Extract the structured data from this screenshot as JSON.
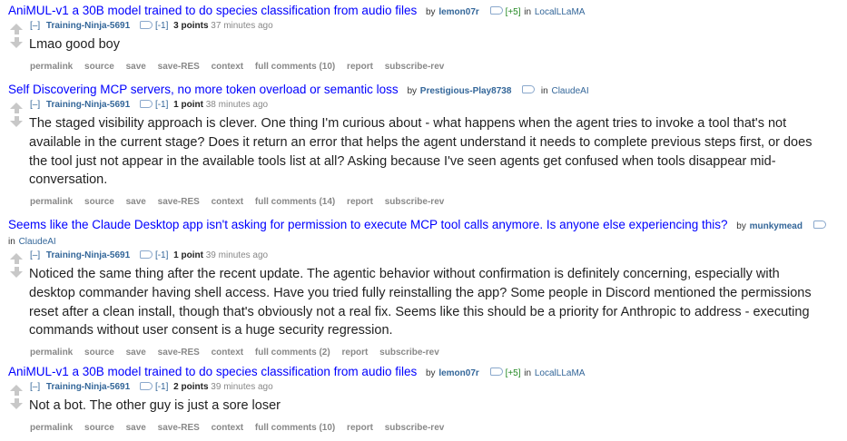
{
  "entries": [
    {
      "title": "AniMUL-v1 a 30B model trained to do species classification from audio files",
      "by": "by",
      "op": "lemon07r",
      "karma": "[+5]",
      "in": "in",
      "subreddit": "LocalLLaMA",
      "expand": "[–]",
      "commenter": "Training-Ninja-5691",
      "flair": "[-1]",
      "score": "3 points",
      "time": "37 minutes ago",
      "body": "Lmao good boy",
      "buttons": [
        "permalink",
        "source",
        "save",
        "save-RES",
        "context",
        "full comments (10)",
        "report",
        "subscribe-rev"
      ]
    },
    {
      "title": "Self Discovering MCP servers, no more token overload or semantic loss",
      "by": "by",
      "op": "Prestigious-Play8738",
      "karma": "",
      "in": "in",
      "subreddit": "ClaudeAI",
      "expand": "[–]",
      "commenter": "Training-Ninja-5691",
      "flair": "[-1]",
      "score": "1 point",
      "time": "38 minutes ago",
      "body": "The staged visibility approach is clever. One thing I'm curious about - what happens when the agent tries to invoke a tool that's not available in the current stage? Does it return an error that helps the agent understand it needs to complete previous steps first, or does the tool just not appear in the available tools list at all? Asking because I've seen agents get confused when tools disappear mid-conversation.",
      "buttons": [
        "permalink",
        "source",
        "save",
        "save-RES",
        "context",
        "full comments (14)",
        "report",
        "subscribe-rev"
      ]
    },
    {
      "title": "Seems like the Claude Desktop app isn't asking for permission to execute MCP tool calls anymore. Is anyone else experiencing this?",
      "by": "by",
      "op": "munkymead",
      "karma": "",
      "in": "in",
      "subreddit": "ClaudeAI",
      "expand": "[–]",
      "commenter": "Training-Ninja-5691",
      "flair": "[-1]",
      "score": "1 point",
      "time": "39 minutes ago",
      "body": "Noticed the same thing after the recent update. The agentic behavior without confirmation is definitely concerning, especially with desktop commander having shell access. Have you tried fully reinstalling the app? Some people in Discord mentioned the permissions reset after a clean install, though that's obviously not a real fix. Seems like this should be a priority for Anthropic to address - executing commands without user consent is a huge security regression.",
      "buttons": [
        "permalink",
        "source",
        "save",
        "save-RES",
        "context",
        "full comments (2)",
        "report",
        "subscribe-rev"
      ]
    },
    {
      "title": "AniMUL-v1 a 30B model trained to do species classification from audio files",
      "by": "by",
      "op": "lemon07r",
      "karma": "[+5]",
      "in": "in",
      "subreddit": "LocalLLaMA",
      "expand": "[–]",
      "commenter": "Training-Ninja-5691",
      "flair": "[-1]",
      "score": "2 points",
      "time": "39 minutes ago",
      "body": "Not a bot. The other guy is just a sore loser",
      "buttons": [
        "permalink",
        "source",
        "save",
        "save-RES",
        "context",
        "full comments (10)",
        "report",
        "subscribe-rev"
      ]
    }
  ]
}
